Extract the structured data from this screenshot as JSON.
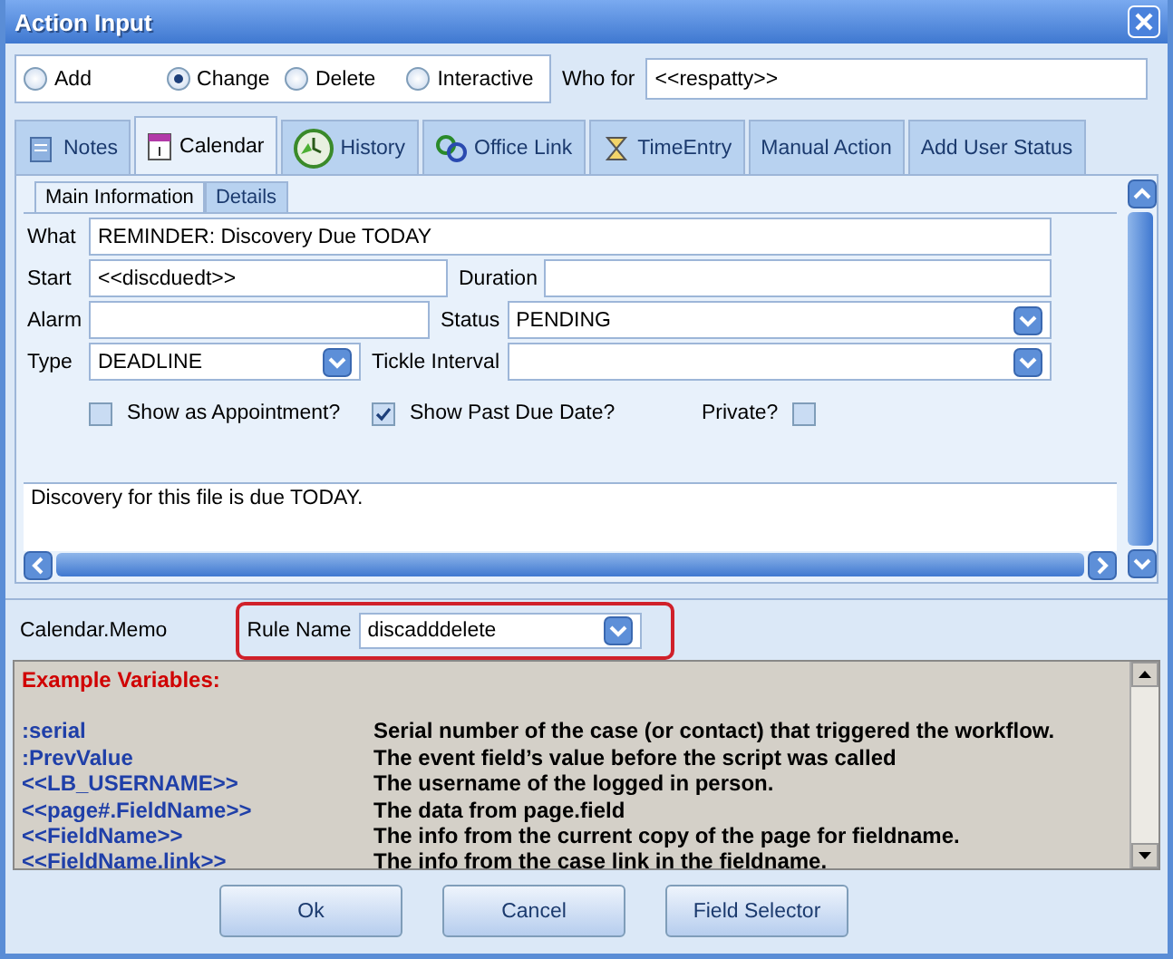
{
  "window": {
    "title": "Action Input"
  },
  "actions": [
    {
      "label": "Add",
      "selected": false
    },
    {
      "label": "Change",
      "selected": true
    },
    {
      "label": "Delete",
      "selected": false
    },
    {
      "label": "Interactive",
      "selected": false
    }
  ],
  "who_for": {
    "label": "Who for",
    "value": "<<respatty>>"
  },
  "tabs": [
    {
      "label": "Notes",
      "selected": false
    },
    {
      "label": "Calendar",
      "selected": true
    },
    {
      "label": "History",
      "selected": false
    },
    {
      "label": "Office Link",
      "selected": false
    },
    {
      "label": "TimeEntry",
      "selected": false
    },
    {
      "label": "Manual Action",
      "selected": false
    },
    {
      "label": "Add User Status",
      "selected": false
    }
  ],
  "subtabs": [
    {
      "label": "Main Information",
      "selected": true
    },
    {
      "label": "Details",
      "selected": false
    }
  ],
  "form_rows": [
    [
      {
        "label": "What",
        "value": "REMINDER: Discovery Due TODAY",
        "kind": "text"
      }
    ],
    [
      {
        "label": "Start",
        "value": "<<discduedt>>",
        "kind": "text"
      },
      {
        "label": "Duration",
        "kind": "text"
      }
    ],
    [
      {
        "label": "Alarm",
        "kind": "text"
      },
      {
        "label": "Status",
        "value": "PENDING",
        "kind": "select"
      }
    ],
    [
      {
        "label": "Type",
        "value": "DEADLINE",
        "kind": "select"
      },
      {
        "label": "Tickle Interval",
        "kind": "select"
      }
    ]
  ],
  "checkboxes": [
    {
      "label": "Show as Appointment?",
      "checked": false,
      "kind": "box-first"
    },
    {
      "label": "Show Past Due Date?",
      "checked": true,
      "kind": "box-first"
    },
    {
      "label": "Private?",
      "checked": false,
      "kind": "label-first"
    }
  ],
  "memo": {
    "text": "Discovery for this file is due TODAY."
  },
  "rule_bar": {
    "field_label": "Calendar.Memo",
    "rule_label": "Rule Name",
    "rule_value": "discadddelete"
  },
  "help": {
    "heading": "Example Variables:",
    "variables": [
      {
        "name": ":serial",
        "description": "Serial number of the case (or contact) that triggered the workflow."
      },
      {
        "name": ":PrevValue",
        "description": "The event field’s value before the script was called"
      },
      {
        "name": "<<LB_USERNAME>>",
        "description": "The username of the logged in person."
      },
      {
        "name": "<<page#.FieldName>>",
        "description": "The data from page.field"
      },
      {
        "name": "<<FieldName>>",
        "description": "The info from the current copy of the page for fieldname."
      },
      {
        "name": "<<FieldName.link>>",
        "description": "The info from the case link in the fieldname."
      }
    ]
  },
  "buttons": [
    "Ok",
    "Cancel",
    "Field Selector"
  ]
}
